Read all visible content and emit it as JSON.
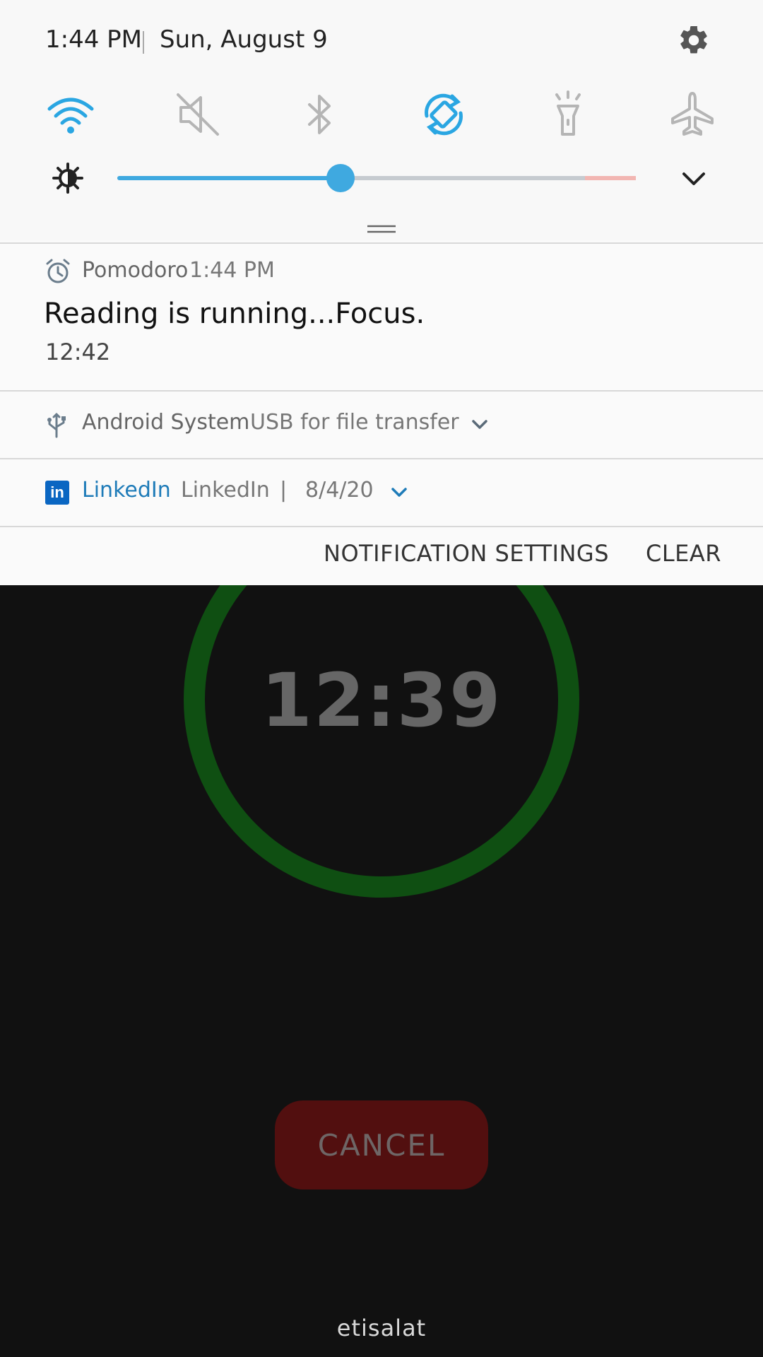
{
  "status_bar": {
    "time": "1:44 PM",
    "date": "Sun, August 9",
    "settings_icon": "gear-icon"
  },
  "quick_settings": {
    "tiles": [
      {
        "name": "wifi",
        "icon": "wifi-icon",
        "active": true
      },
      {
        "name": "sound",
        "icon": "mute-icon",
        "active": false
      },
      {
        "name": "bluetooth",
        "icon": "bluetooth-icon",
        "active": false
      },
      {
        "name": "auto-rotate",
        "icon": "rotate-icon",
        "active": true
      },
      {
        "name": "flashlight",
        "icon": "flashlight-icon",
        "active": false
      },
      {
        "name": "airplane-mode",
        "icon": "airplane-icon",
        "active": false
      }
    ],
    "brightness_level": 0.43,
    "active_color": "#3fa9e0",
    "inactive_color": "#b5b5b5"
  },
  "notifications": {
    "pomodoro": {
      "app": "Pomodoro",
      "time": "1:44 PM",
      "title": "Reading  is running...Focus.",
      "body": "12:42"
    },
    "android": {
      "app": "Android System",
      "text": "USB for file transfer"
    },
    "linkedin": {
      "app": "LinkedIn",
      "logo_text": "in",
      "text": "LinkedIn",
      "separator": "|",
      "date": "8/4/20"
    }
  },
  "shade_actions": {
    "notification_settings": "NOTIFICATION SETTINGS",
    "clear": "CLEAR"
  },
  "app": {
    "timer": "12:39",
    "cancel": "CANCEL",
    "carrier": "etisalat",
    "ring_color": "#0f4f12",
    "cancel_color": "#520f0f"
  }
}
